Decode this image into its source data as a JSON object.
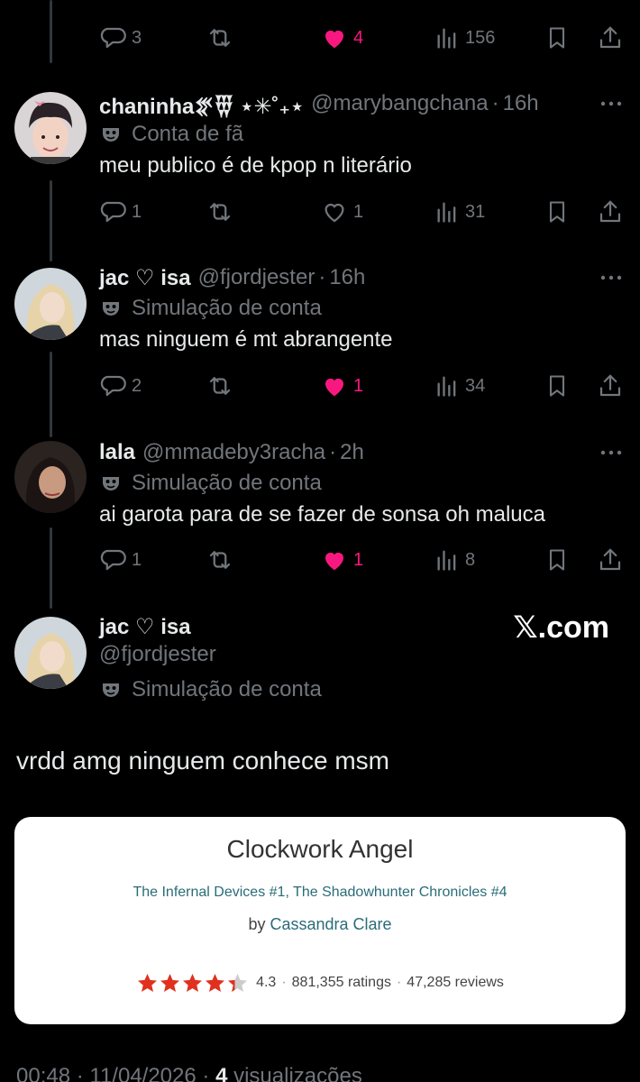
{
  "top_actions": {
    "replies": "3",
    "likes": "4",
    "views": "156"
  },
  "replies": [
    {
      "name": "chaninha𒐐𒑄 ⋆✳︎˚₊⋆",
      "handle": "@marybangchana",
      "time": "16h",
      "label": "Conta de fã",
      "text": "meu publico é de kpop n literário",
      "replies": "1",
      "likes": "1",
      "views": "31"
    },
    {
      "name": "jac ♡ isa",
      "handle": "@fjordjester",
      "time": "16h",
      "label": "Simulação de conta",
      "text": "mas ninguem é mt abrangente",
      "replies": "2",
      "likes": "1",
      "views": "34"
    },
    {
      "name": "lala",
      "handle": "@mmadeby3racha",
      "time": "2h",
      "label": "Simulação de conta",
      "text": "ai garota para de se fazer de sonsa oh maluca",
      "replies": "1",
      "likes": "1",
      "views": "8"
    }
  ],
  "main_post": {
    "name": "jac ♡ isa",
    "handle": "@fjordjester",
    "label": "Simulação de conta",
    "text": "vrdd amg ninguem conhece msm",
    "watermark": "𝕏.com"
  },
  "book_card": {
    "title": "Clockwork Angel",
    "series": "The Infernal Devices #1, The Shadowhunter Chronicles #4",
    "by": "by",
    "author": "Cassandra Clare",
    "rating": "4.3",
    "ratings_count": "881,355 ratings",
    "reviews_count": "47,285 reviews",
    "stars_rating": 4.3
  },
  "footer": {
    "time": "00:48 · 11/04/2026 ·",
    "views": "4",
    "views_label": "visualizações"
  },
  "colors": {
    "like": "#f91880",
    "muted": "#71767b",
    "text": "#e7e9ea",
    "star": "#e0301e",
    "series_link": "#2a6c78"
  },
  "icons": [
    "reply-icon",
    "retweet-icon",
    "heart-icon",
    "views-icon",
    "bookmark-icon",
    "share-icon",
    "more-icon",
    "mask-icon",
    "star-icon"
  ]
}
